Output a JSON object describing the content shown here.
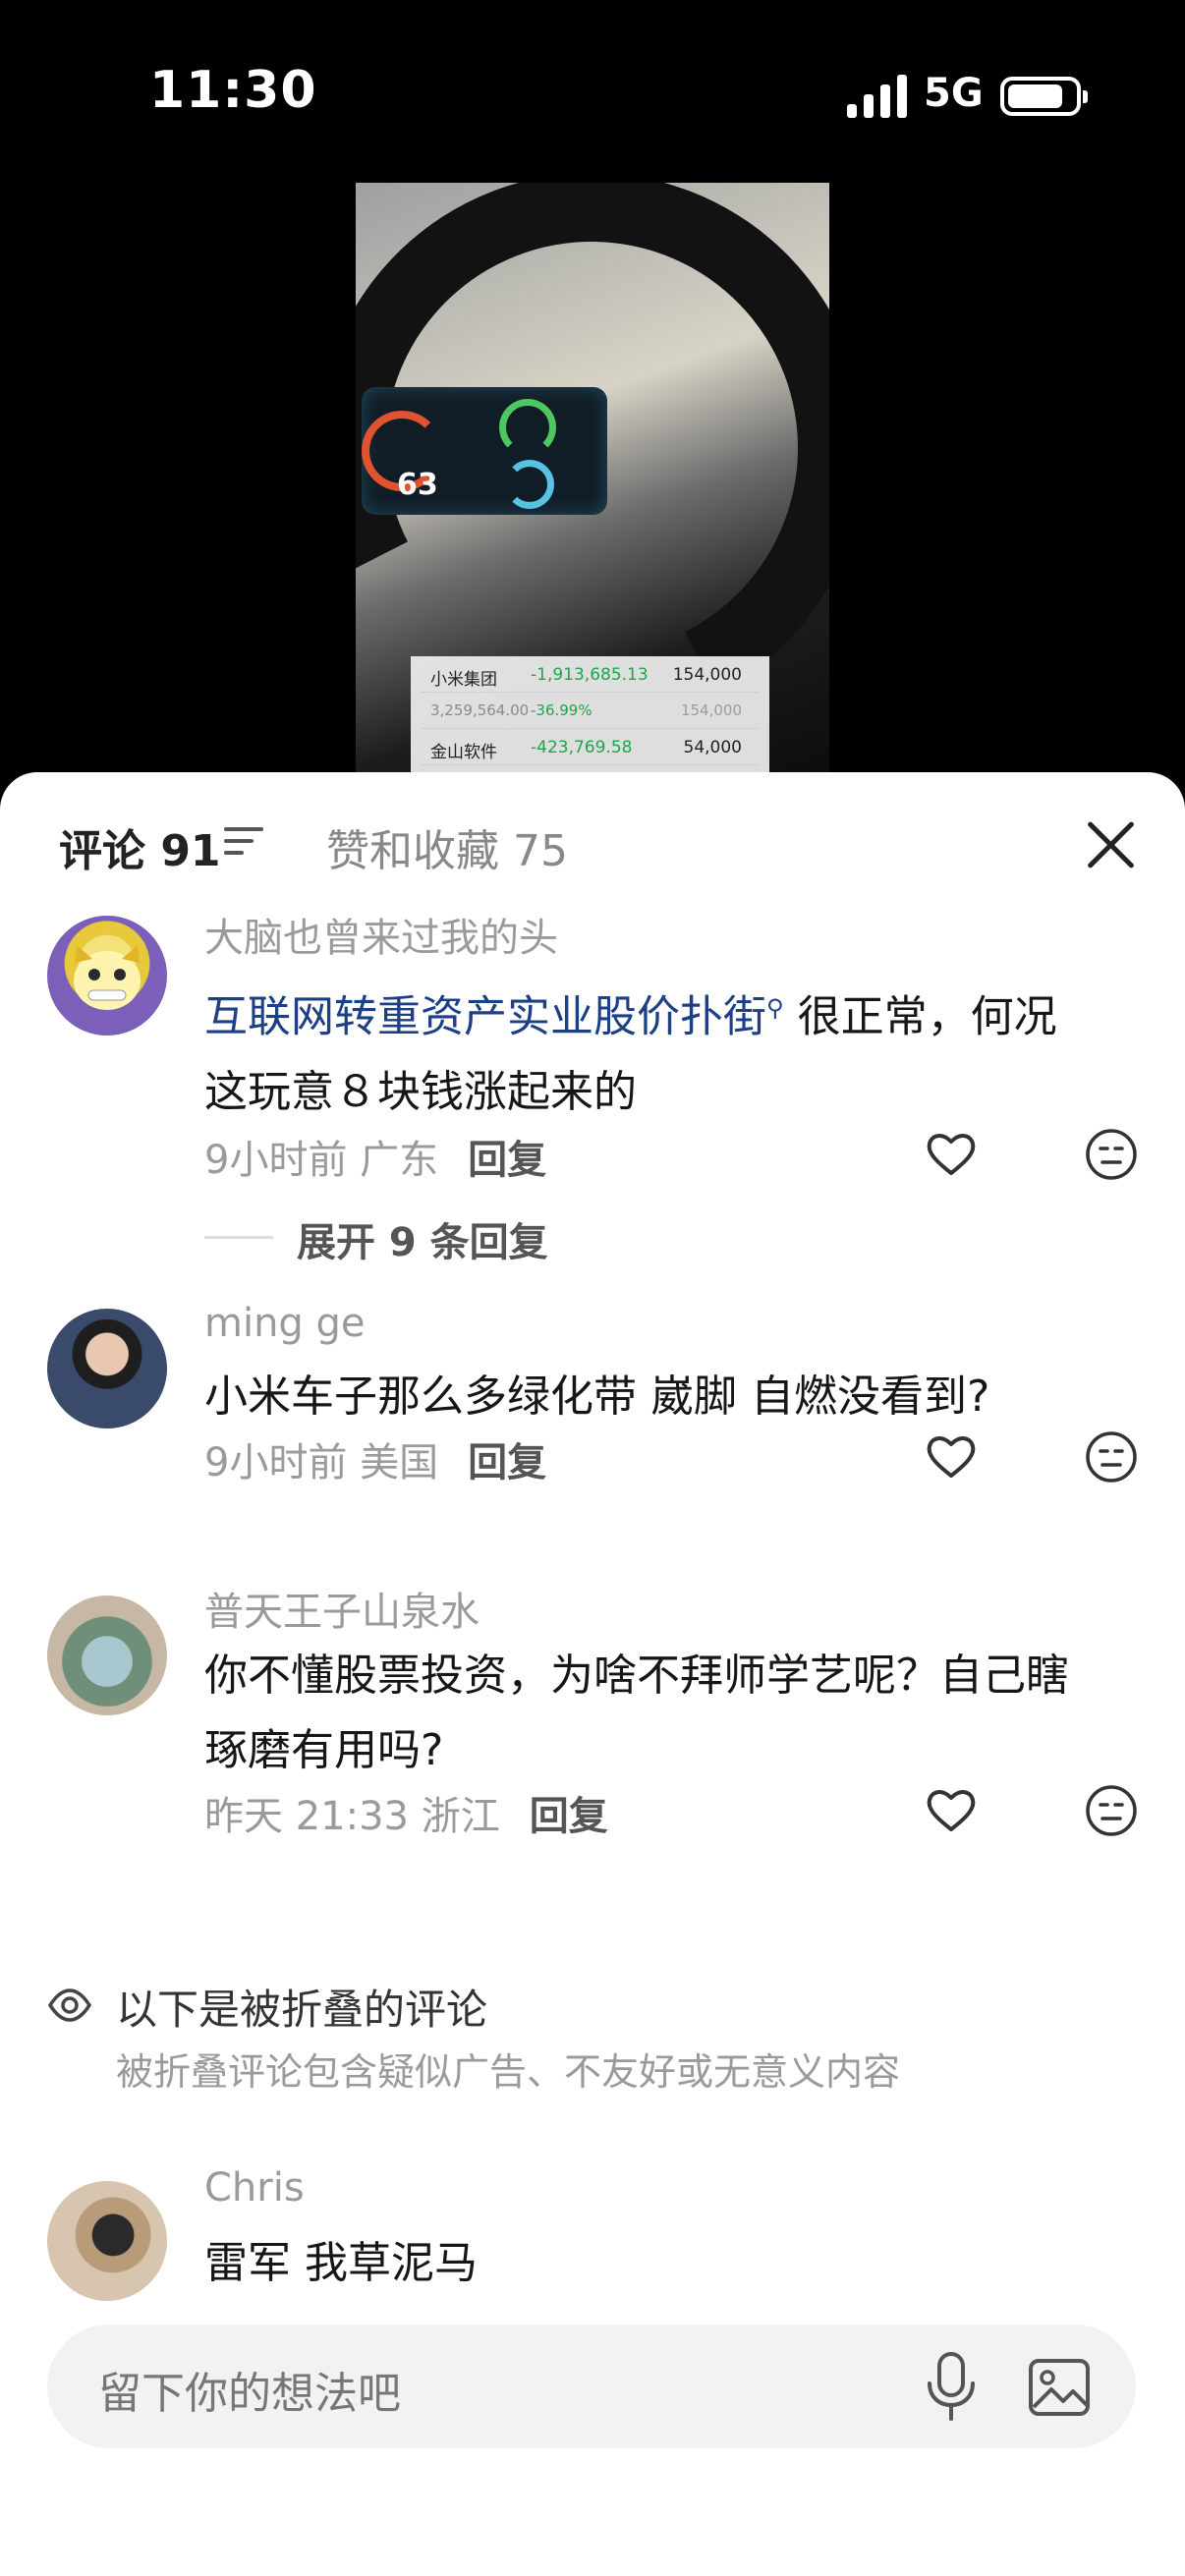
{
  "status_bar": {
    "time": "11:30",
    "network": "5G",
    "battery_level": 0.85
  },
  "video_overlay": {
    "dashboard_speed": "63",
    "stock_rows": [
      {
        "name": "小米集团",
        "change": "-1,913,685.13",
        "shares": "154,000"
      },
      {
        "name": "3,259,564.00",
        "change": "-36.99%",
        "shares": "154,000"
      },
      {
        "name": "金山软件",
        "change": "-423,769.58",
        "shares": "54,000"
      }
    ]
  },
  "sheet": {
    "tab_comments": "评论 91",
    "tab_likes": "赞和收藏 75"
  },
  "comments": [
    {
      "author": "大脑也曾来过我的头",
      "highlight": "互联网转重资产实业股价扑街",
      "text_after_highlight": " 很正常，何况",
      "text_line2": "这玩意８块钱涨起来的",
      "meta": "9小时前 广东",
      "reply": "回复",
      "expand": "展开 9 条回复"
    },
    {
      "author": "ming ge",
      "text": "小米车子那么多绿化带 崴脚 自燃没看到?",
      "meta": "9小时前 美国",
      "reply": "回复"
    },
    {
      "author": "普天王子山泉水",
      "text_line1": "你不懂股票投资，为啥不拜师学艺呢？自己瞎",
      "text_line2": "琢磨有用吗?",
      "meta": "昨天 21:33 浙江",
      "reply": "回复"
    },
    {
      "author": "Chris",
      "text": "雷军 我草泥马"
    }
  ],
  "folded": {
    "title": "以下是被折叠的评论",
    "subtitle": "被折叠评论包含疑似广告、不友好或无意义内容"
  },
  "input": {
    "placeholder": "留下你的想法吧"
  },
  "colors": {
    "highlight_link": "#1c3f86",
    "meta_gray": "#9a9a9a",
    "sheet_bg": "#ffffff"
  }
}
